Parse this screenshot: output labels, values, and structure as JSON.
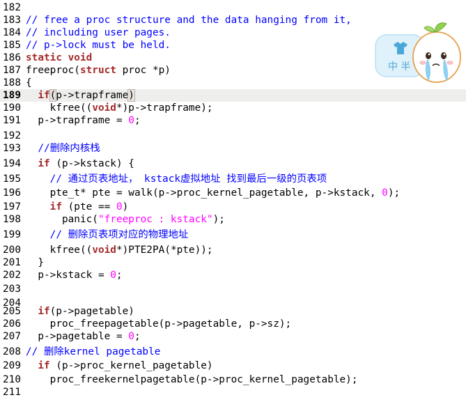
{
  "editor": {
    "current_line": "189",
    "lines": [
      {
        "n": "182",
        "tokens": []
      },
      {
        "n": "183",
        "tokens": [
          {
            "t": "// free a proc structure and the data hanging from it,",
            "c": "cm"
          }
        ]
      },
      {
        "n": "184",
        "tokens": [
          {
            "t": "// including user pages.",
            "c": "cm"
          }
        ]
      },
      {
        "n": "185",
        "tokens": [
          {
            "t": "// p->lock must be held.",
            "c": "cm"
          }
        ]
      },
      {
        "n": "186",
        "tokens": [
          {
            "t": "static void",
            "c": "kw"
          }
        ]
      },
      {
        "n": "187",
        "tokens": [
          {
            "t": "freeproc(",
            "c": ""
          },
          {
            "t": "struct",
            "c": "kw"
          },
          {
            "t": " proc *p)",
            "c": ""
          }
        ]
      },
      {
        "n": "188",
        "tokens": [
          {
            "t": "{",
            "c": ""
          }
        ]
      },
      {
        "n": "189",
        "tokens": [
          {
            "t": "  ",
            "c": ""
          },
          {
            "t": "if",
            "c": "kw"
          },
          {
            "t": "(",
            "c": "cur"
          },
          {
            "t": "p->trapframe",
            "c": ""
          },
          {
            "t": ")",
            "c": "cur"
          }
        ]
      },
      {
        "n": "190",
        "tokens": [
          {
            "t": "    kfree((",
            "c": ""
          },
          {
            "t": "void",
            "c": "kw"
          },
          {
            "t": "*)p->trapframe);",
            "c": ""
          }
        ]
      },
      {
        "n": "191",
        "tokens": [
          {
            "t": "  p->trapframe = ",
            "c": ""
          },
          {
            "t": "0",
            "c": "num"
          },
          {
            "t": ";",
            "c": ""
          }
        ]
      },
      {
        "n": "192",
        "tokens": []
      },
      {
        "n": "193",
        "tokens": [
          {
            "t": "  //删除内核栈",
            "c": "cm"
          }
        ]
      },
      {
        "n": "194",
        "tokens": [
          {
            "t": "  ",
            "c": ""
          },
          {
            "t": "if",
            "c": "kw"
          },
          {
            "t": " (p->kstack) {",
            "c": ""
          }
        ]
      },
      {
        "n": "195",
        "tokens": [
          {
            "t": "    // 通过页表地址， kstack虚拟地址 找到最后一级的页表项",
            "c": "cm"
          }
        ]
      },
      {
        "n": "196",
        "tokens": [
          {
            "t": "    pte_t* pte = walk(p->proc_kernel_pagetable, p->kstack, ",
            "c": ""
          },
          {
            "t": "0",
            "c": "num"
          },
          {
            "t": ");",
            "c": ""
          }
        ]
      },
      {
        "n": "197",
        "tokens": [
          {
            "t": "    ",
            "c": ""
          },
          {
            "t": "if",
            "c": "kw"
          },
          {
            "t": " (pte == ",
            "c": ""
          },
          {
            "t": "0",
            "c": "num"
          },
          {
            "t": ")",
            "c": ""
          }
        ]
      },
      {
        "n": "198",
        "tokens": [
          {
            "t": "      panic(",
            "c": ""
          },
          {
            "t": "\"freeproc : kstack\"",
            "c": "str"
          },
          {
            "t": ");",
            "c": ""
          }
        ]
      },
      {
        "n": "199",
        "tokens": [
          {
            "t": "    // 删除页表项对应的物理地址",
            "c": "cm"
          }
        ]
      },
      {
        "n": "200",
        "tokens": [
          {
            "t": "    kfree((",
            "c": ""
          },
          {
            "t": "void",
            "c": "kw"
          },
          {
            "t": "*)PTE2PA(*pte));",
            "c": ""
          }
        ]
      },
      {
        "n": "201",
        "tokens": [
          {
            "t": "  }",
            "c": ""
          }
        ]
      },
      {
        "n": "202",
        "tokens": [
          {
            "t": "  p->kstack = ",
            "c": ""
          },
          {
            "t": "0",
            "c": "num"
          },
          {
            "t": ";",
            "c": ""
          }
        ]
      },
      {
        "n": "203",
        "tokens": []
      },
      {
        "n": "204",
        "tokens": []
      },
      {
        "n": "205",
        "tokens": [
          {
            "t": "  ",
            "c": ""
          },
          {
            "t": "if",
            "c": "kw"
          },
          {
            "t": "(p->pagetable)",
            "c": ""
          }
        ]
      },
      {
        "n": "206",
        "tokens": [
          {
            "t": "    proc_freepagetable(p->pagetable, p->sz);",
            "c": ""
          }
        ]
      },
      {
        "n": "207",
        "tokens": [
          {
            "t": "  p->pagetable = ",
            "c": ""
          },
          {
            "t": "0",
            "c": "num"
          },
          {
            "t": ";",
            "c": ""
          }
        ]
      },
      {
        "n": "208",
        "tokens": [
          {
            "t": "// 删除kernel pagetable",
            "c": "cm"
          }
        ]
      },
      {
        "n": "209",
        "tokens": [
          {
            "t": "  ",
            "c": ""
          },
          {
            "t": "if",
            "c": "kw"
          },
          {
            "t": " (p->proc_kernel_pagetable)",
            "c": ""
          }
        ]
      },
      {
        "n": "210",
        "tokens": [
          {
            "t": "    proc_freekernelpagetable(p->proc_kernel_pagetable);",
            "c": ""
          }
        ]
      },
      {
        "n": "211",
        "tokens": []
      }
    ]
  },
  "mascot": {
    "icon": "cartoon-mascot-icon",
    "shirt_icon": "tshirt-icon",
    "text": "中 半"
  },
  "colors": {
    "keyword": "#a52a2a",
    "comment": "#0000ff",
    "number": "#ff00ff",
    "current_line_bg": "#eeeeec"
  }
}
